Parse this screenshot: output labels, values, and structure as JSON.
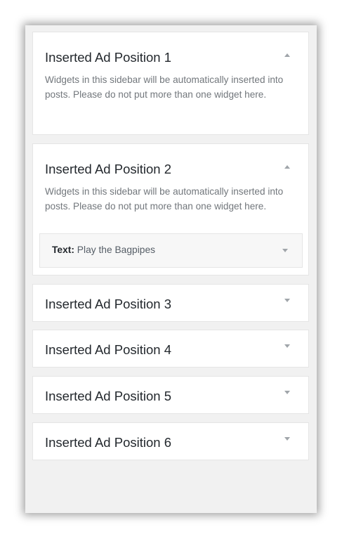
{
  "sidebars": [
    {
      "title": "Inserted Ad Position 1",
      "description": "Widgets in this sidebar will be automatically inserted into posts. Please do not put more than one widget here.",
      "expanded": true,
      "toggle_icon": "arrow-up-icon"
    },
    {
      "title": "Inserted Ad Position 2",
      "description": "Widgets in this sidebar will be automatically inserted into posts. Please do not put more than one widget here.",
      "expanded": true,
      "toggle_icon": "arrow-up-icon",
      "widget": {
        "type_label": "Text:",
        "name": "Play the Bagpipes",
        "toggle_icon": "arrow-down-icon"
      }
    },
    {
      "title": "Inserted Ad Position 3",
      "expanded": false,
      "toggle_icon": "arrow-down-icon"
    },
    {
      "title": "Inserted Ad Position 4",
      "expanded": false,
      "toggle_icon": "arrow-down-icon"
    },
    {
      "title": "Inserted Ad Position 5",
      "expanded": false,
      "toggle_icon": "arrow-down-icon"
    },
    {
      "title": "Inserted Ad Position 6",
      "expanded": false,
      "toggle_icon": "arrow-down-icon"
    }
  ],
  "colors": {
    "panel_background": "#f1f1f1",
    "box_background": "#ffffff",
    "border": "#e5e5e5",
    "title_text": "#23282d",
    "description_text": "#72777c",
    "arrow": "#a0a5aa"
  }
}
